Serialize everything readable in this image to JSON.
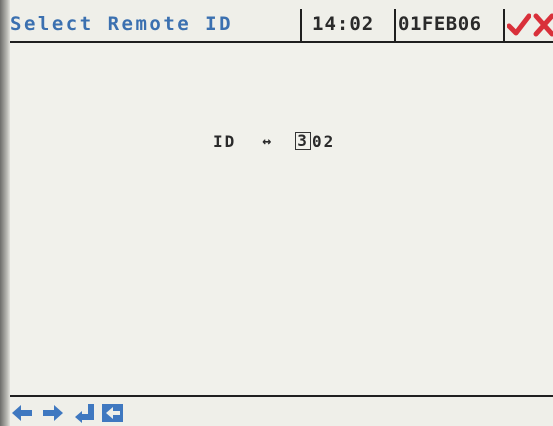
{
  "header": {
    "title": "Select Remote ID",
    "time": "14:02",
    "date": "01FEB06"
  },
  "main": {
    "id_label": "ID",
    "id_arrow": "↔",
    "id_cursor_digit": "3",
    "id_rest": "02"
  },
  "colors": {
    "title": "#3b70b0",
    "accept": "#d9303a",
    "cancel": "#d9303a",
    "nav_icons": "#3f78c0"
  },
  "icons": [
    "accept-check-icon",
    "cancel-x-icon",
    "arrow-left-icon",
    "arrow-right-icon",
    "enter-icon",
    "back-icon"
  ]
}
